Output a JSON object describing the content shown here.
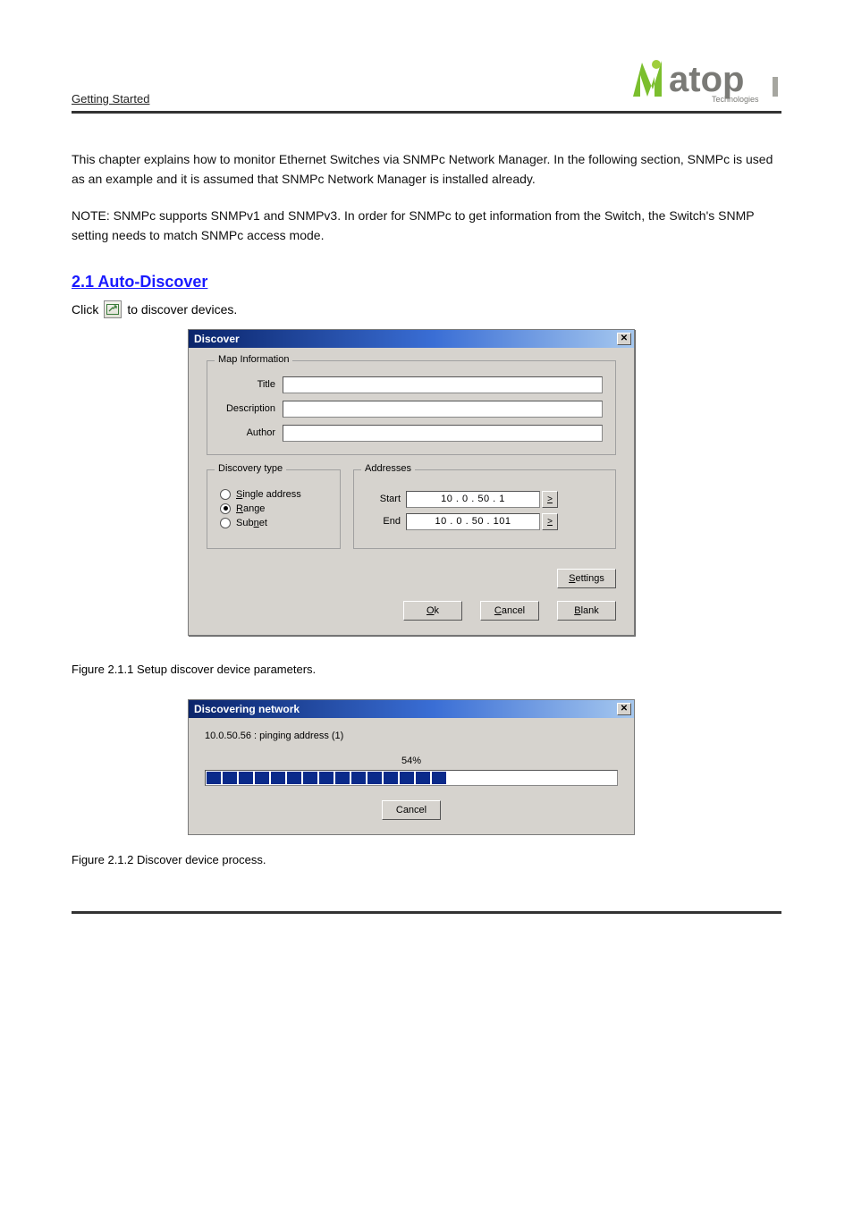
{
  "header": {
    "left_text": "Getting Started",
    "logo_main": "atop",
    "logo_sub": "Technologies"
  },
  "intro_paragraphs": [
    "This chapter explains how to monitor Ethernet Switches via SNMPc Network Manager. In the following section, SNMPc is used as an example and it is assumed that SNMPc Network Manager is installed already.",
    "NOTE: SNMPc supports SNMPv1 and SNMPv3. In order for SNMPc to get information from the Switch, the Switch's SNMP setting needs to match SNMPc access mode."
  ],
  "section_heading": "2.1 Auto-Discover",
  "step1_prefix": "Click ",
  "step1_suffix": " to discover devices.",
  "dialog1": {
    "title": "Discover",
    "group_map": {
      "legend": "Map Information",
      "title_label": "Title",
      "title_value": "",
      "desc_label": "Description",
      "desc_value": "",
      "author_label": "Author",
      "author_value": ""
    },
    "group_disc": {
      "legend": "Discovery type",
      "opt_single": "ingle address",
      "opt_single_u": "S",
      "opt_range": "ange",
      "opt_range_u": "R",
      "opt_subnet": "Sub",
      "opt_subnet_u": "n",
      "opt_subnet_suffix": "et"
    },
    "group_addr": {
      "legend": "Addresses",
      "start_label": "Start",
      "start_value": "10  .   0   .  50  .   1",
      "end_label": "End",
      "end_value": "10  .   0   .  50  . 101",
      "arrow": ">"
    },
    "btn_settings": "ettings",
    "btn_settings_u": "S",
    "btn_ok": "k",
    "btn_ok_u": "O",
    "btn_cancel": "ancel",
    "btn_cancel_u": "C",
    "btn_blank": "lank",
    "btn_blank_u": "B"
  },
  "caption1": "Figure 2.1.1 Setup discover device parameters.",
  "dialog2": {
    "title": "Discovering network",
    "status_text": "10.0.50.56 : pinging address (1)",
    "percent": "54%",
    "btn_cancel": "Cancel"
  },
  "caption2": "Figure 2.1.2 Discover device process."
}
